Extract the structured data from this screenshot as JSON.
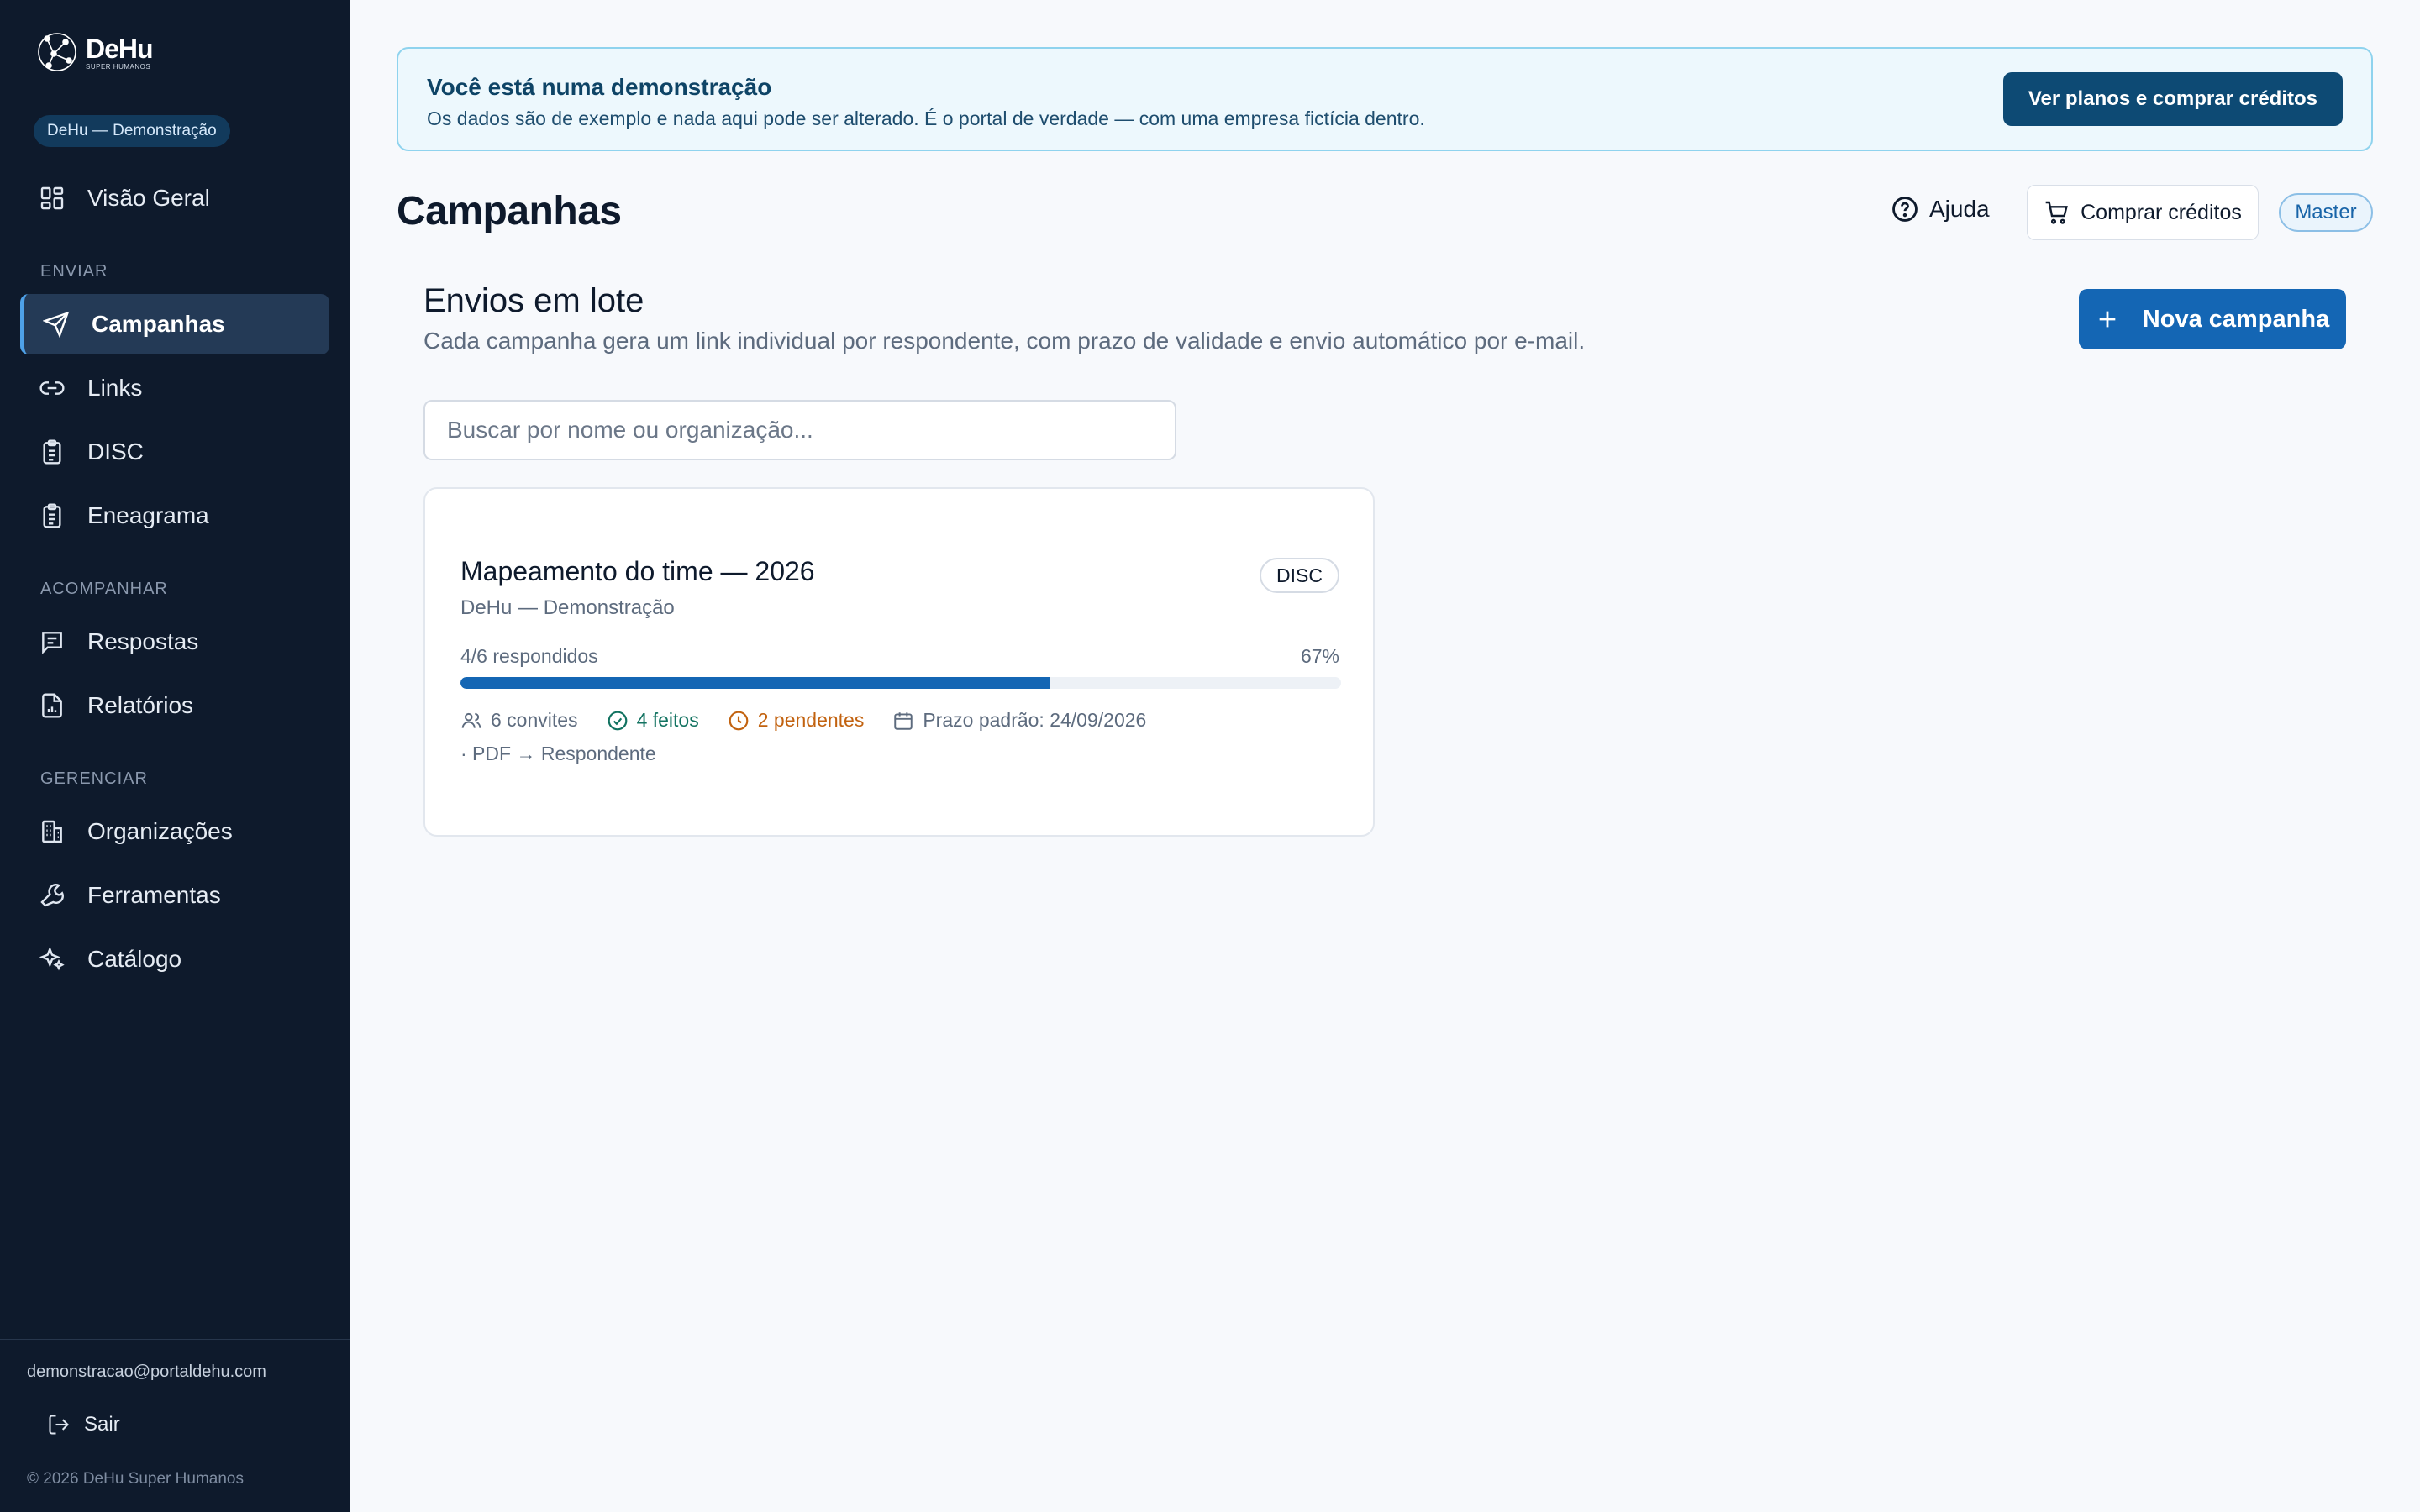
{
  "sidebar": {
    "logo_name": "DeHu",
    "logo_sub": "SUPER HUMANOS",
    "org_badge": "DeHu — Demonstração",
    "overview": "Visão Geral",
    "sections": {
      "send": "ENVIAR",
      "follow": "ACOMPANHAR",
      "manage": "GERENCIAR"
    },
    "items": {
      "campaigns": "Campanhas",
      "links": "Links",
      "disc": "DISC",
      "enneagram": "Eneagrama",
      "responses": "Respostas",
      "reports": "Relatórios",
      "organizations": "Organizações",
      "tools": "Ferramentas",
      "catalog": "Catálogo"
    },
    "user_email": "demonstracao@portaldehu.com",
    "logout": "Sair",
    "copyright": "© 2026 DeHu Super Humanos"
  },
  "banner": {
    "title": "Você está numa demonstração",
    "text": "Os dados são de exemplo e nada aqui pode ser alterado. É o portal de verdade — com uma empresa fictícia dentro.",
    "button": "Ver planos e comprar créditos"
  },
  "header": {
    "title": "Campanhas",
    "help": "Ajuda",
    "buy_credits": "Comprar créditos",
    "role": "Master"
  },
  "section": {
    "title": "Envios em lote",
    "subtitle": "Cada campanha gera um link individual por respondente, com prazo de validade e envio automático por e-mail.",
    "new_button": "Nova campanha",
    "search_placeholder": "Buscar por nome ou organização..."
  },
  "campaign": {
    "title": "Mapeamento do time — 2026",
    "tag": "DISC",
    "org": "DeHu — Demonstração",
    "progress_label": "4/6 respondidos",
    "progress_pct": "67%",
    "progress_value": 0.67,
    "invites": "6 convites",
    "done": "4 feitos",
    "pending": "2 pendentes",
    "deadline": "Prazo padrão: 24/09/2026",
    "footer": "· PDF → Respondente"
  }
}
